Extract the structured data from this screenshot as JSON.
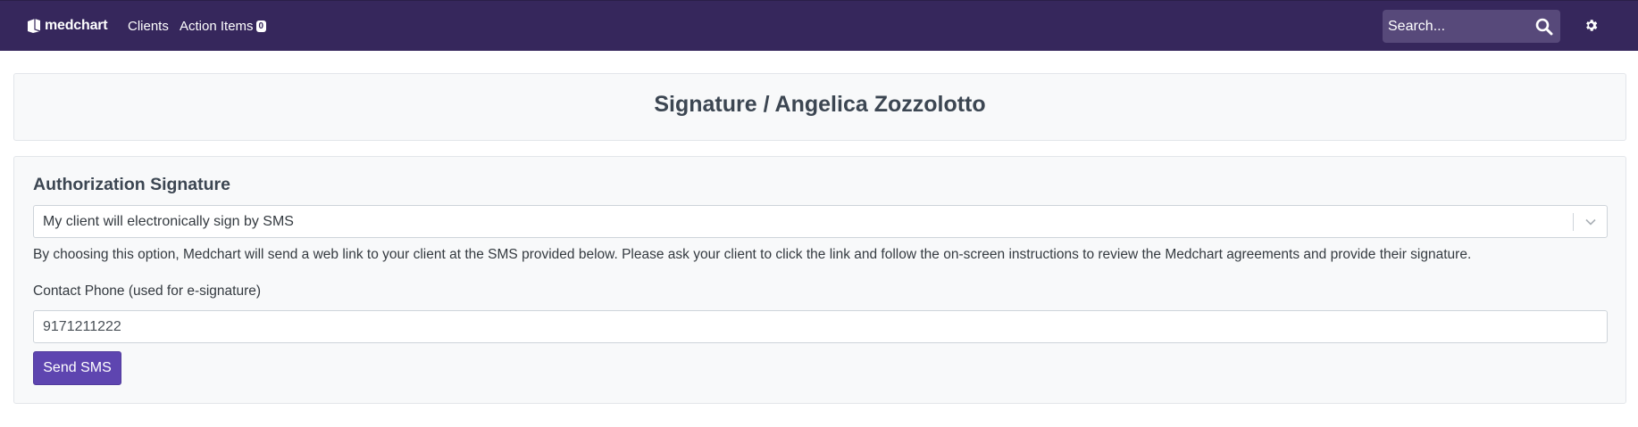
{
  "nav": {
    "brand": "medchart",
    "links": {
      "clients": "Clients",
      "action_items": "Action Items",
      "action_items_count": "0"
    },
    "search": {
      "placeholder": "Search..."
    }
  },
  "page": {
    "title": "Signature / Angelica Zozzolotto"
  },
  "auth": {
    "heading": "Authorization Signature",
    "method_select": {
      "value": "My client will electronically sign by SMS"
    },
    "help_text": "By choosing this option, Medchart will send a web link to your client at the SMS provided below. Please ask your client to click the link and follow the on-screen instructions to review the Medchart agreements and provide their signature.",
    "phone_label": "Contact Phone (used for e-signature)",
    "phone_value": "9171211222",
    "send_button": "Send SMS"
  },
  "colors": {
    "navbar": "#36275c",
    "primary_button": "#5e45b0",
    "card_background": "#f8f9fa"
  },
  "icons": [
    "medchart-logo-icon",
    "search-icon",
    "gear-icon",
    "chevron-down-icon"
  ]
}
